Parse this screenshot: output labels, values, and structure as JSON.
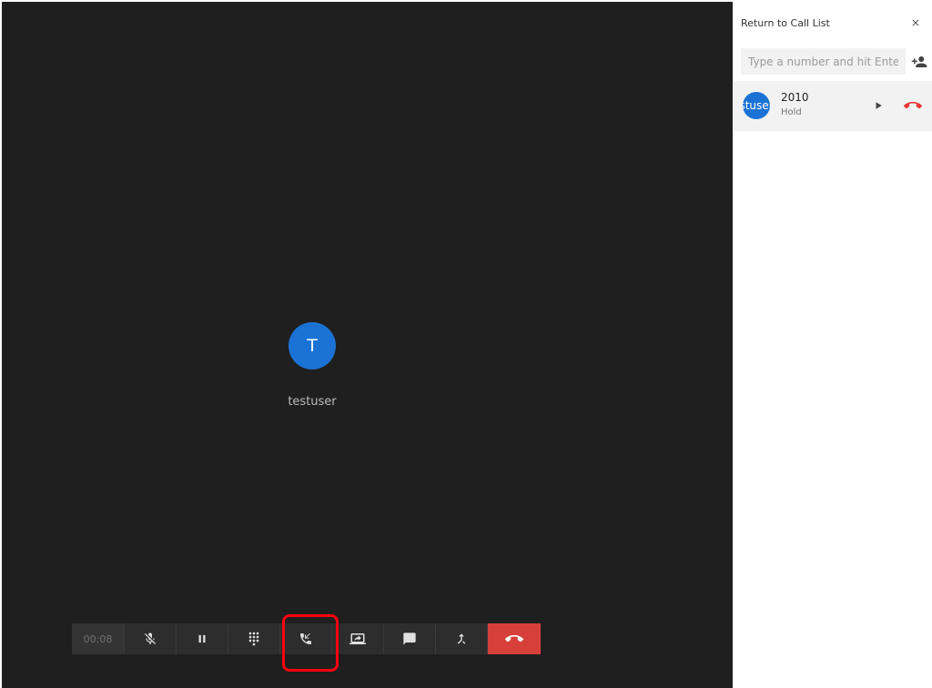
{
  "call": {
    "avatar_initial": "T",
    "caller_name": "testuser",
    "timer": "00:08"
  },
  "toolbar": {
    "buttons": [
      {
        "name": "mute",
        "icon": "mic-off-icon"
      },
      {
        "name": "hold",
        "icon": "pause-icon"
      },
      {
        "name": "keypad",
        "icon": "dialpad-icon"
      },
      {
        "name": "call-list",
        "icon": "phone-callback-icon"
      },
      {
        "name": "screen-share",
        "icon": "screen-share-icon"
      },
      {
        "name": "chat",
        "icon": "chat-icon"
      },
      {
        "name": "merge",
        "icon": "merge-icon"
      },
      {
        "name": "hangup",
        "icon": "call-end-icon"
      }
    ]
  },
  "sidebar": {
    "return_label": "Return to Call List",
    "dial_placeholder": "Type a number and hit Enter",
    "calls": [
      {
        "avatar": "stuser",
        "number": "2010",
        "status": "Hold"
      }
    ]
  },
  "colors": {
    "call_bg": "#1f1f1f",
    "avatar_blue": "#1a73d4",
    "hangup_red": "#d7403a",
    "highlight_red": "#ff0010"
  }
}
